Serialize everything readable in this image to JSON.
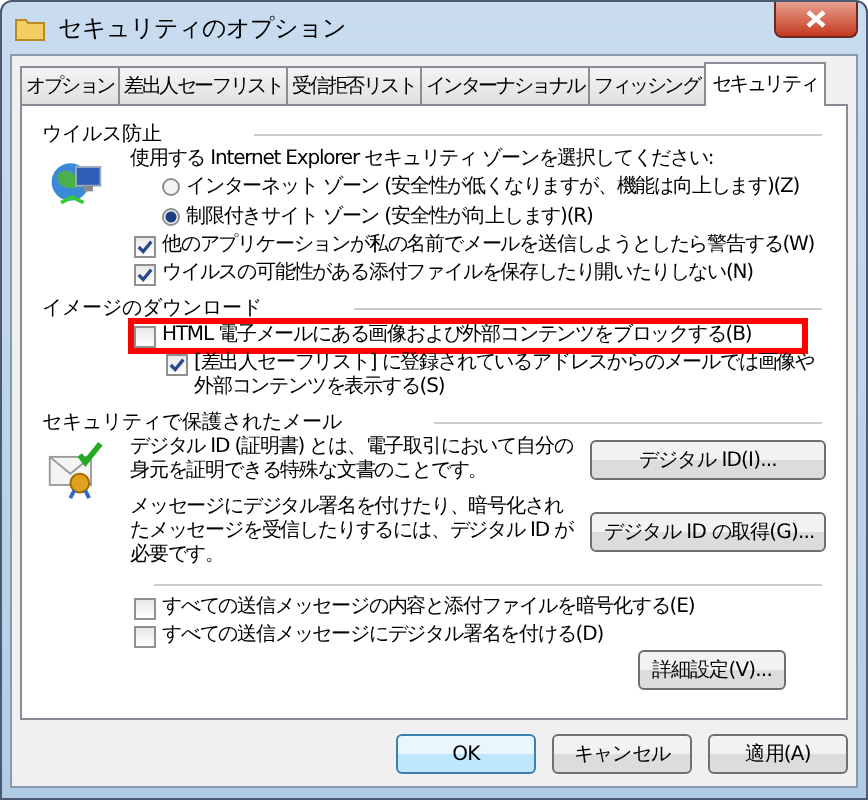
{
  "window": {
    "title": "セキュリティのオプション"
  },
  "tabs": [
    {
      "label": "オプション",
      "selected": false
    },
    {
      "label": "差出人セーフリスト",
      "selected": false
    },
    {
      "label": "受信拒否リスト",
      "selected": false
    },
    {
      "label": "インターナショナル",
      "selected": false
    },
    {
      "label": "フィッシング",
      "selected": false
    },
    {
      "label": "セキュリティ",
      "selected": true
    }
  ],
  "virus_protection": {
    "title": "ウイルス防止",
    "prompt": "使用する Internet Explorer セキュリティ ゾーンを選択してください:",
    "zones": [
      {
        "label": "インターネット ゾーン (安全性が低くなりますが、機能は向上します)(Z)",
        "selected": false
      },
      {
        "label": "制限付きサイト ゾーン (安全性が向上します)(R)",
        "selected": true
      }
    ],
    "options": [
      {
        "label": "他のアプリケーションが私の名前でメールを送信しようとしたら警告する(W)",
        "checked": true
      },
      {
        "label": "ウイルスの可能性がある添付ファイルを保存したり開いたりしない(N)",
        "checked": true
      }
    ]
  },
  "image_download": {
    "title": "イメージのダウンロード",
    "options": [
      {
        "label": "HTML 電子メールにある画像および外部コンテンツをブロックする(B)",
        "checked": false,
        "highlighted": true,
        "children": [
          {
            "label": "[差出人セーフリスト] に登録されているアドレスからのメールでは画像や外部コンテンツを表示する(S)",
            "checked": true,
            "highlighted": false
          }
        ]
      }
    ]
  },
  "secure_mail": {
    "title": "セキュリティで保護されたメール",
    "rows": [
      {
        "text": "デジタル ID (証明書) とは、電子取引において自分の身元を証明できる特殊な文書のことです。",
        "button": "デジタル ID(I)..."
      },
      {
        "text": "メッセージにデジタル署名を付けたり、暗号化されたメッセージを受信したりするには、デジタル ID が必要です。",
        "button": "デジタル ID の取得(G)..."
      }
    ],
    "options": [
      {
        "label": "すべての送信メッセージの内容と添付ファイルを暗号化する(E)",
        "checked": false
      },
      {
        "label": "すべての送信メッセージにデジタル署名を付ける(D)",
        "checked": false
      }
    ],
    "advanced_button": "詳細設定(V)..."
  },
  "buttons": [
    {
      "label": "OK",
      "default": true
    },
    {
      "label": "キャンセル",
      "default": false
    },
    {
      "label": "適用(A)",
      "default": false
    }
  ]
}
